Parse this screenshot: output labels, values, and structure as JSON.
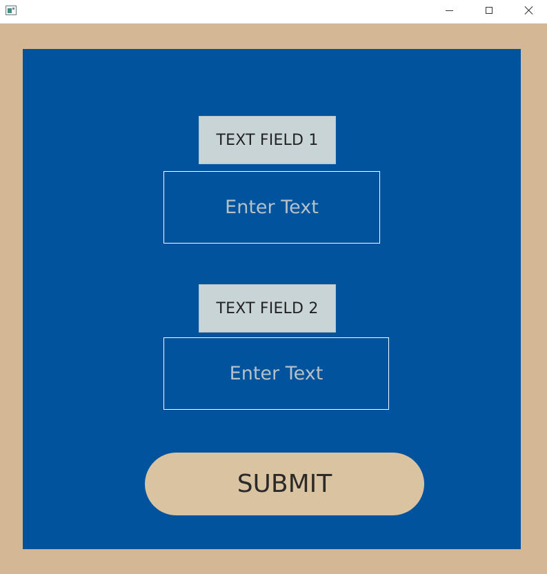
{
  "window": {
    "icon": "app-window-icon",
    "controls": [
      "minimize-icon",
      "maximize-icon",
      "close-icon"
    ]
  },
  "form": {
    "field1": {
      "label": "TEXT FIELD 1",
      "placeholder": "Enter Text",
      "value": ""
    },
    "field2": {
      "label": "TEXT FIELD 2",
      "placeholder": "Enter Text",
      "value": ""
    },
    "submit_label": "SUBMIT"
  },
  "colors": {
    "frame_background": "#d4b896",
    "panel_background": "#00539c",
    "label_background": "#c9d4d7",
    "input_border": "#ffffff",
    "placeholder_text": "#b5c1c8",
    "submit_background": "#d9c3a0"
  }
}
